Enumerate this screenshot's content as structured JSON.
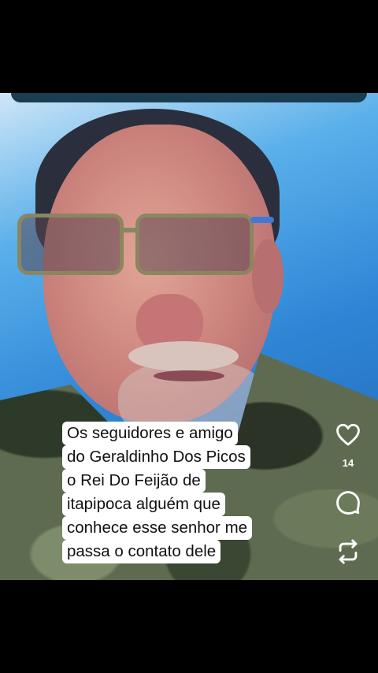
{
  "post": {
    "caption_lines": [
      "Os seguidores e amigo",
      "do Geraldinho Dos Picos",
      "o Rei Do Feijão de",
      "itapipoca alguém que",
      "conhece esse senhor me",
      "passa o contato dele"
    ],
    "like_count": "14"
  },
  "icons": {
    "like": "heart-icon",
    "comment": "comment-bubble-icon",
    "repost": "repost-icon"
  },
  "colors": {
    "caption_bg": "#ffffff",
    "icon": "#ffffff"
  }
}
